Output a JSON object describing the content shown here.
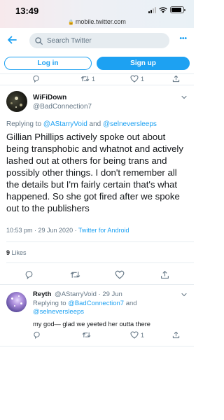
{
  "status_bar": {
    "time": "13:49",
    "url": "mobile.twitter.com"
  },
  "header": {
    "search_placeholder": "Search Twitter"
  },
  "auth": {
    "login_label": "Log in",
    "signup_label": "Sign up"
  },
  "previous_tweet_actions": {
    "retweets": "1",
    "likes": "1"
  },
  "tweet": {
    "display_name": "WiFiDown",
    "handle": "@BadConnection7",
    "replying_prefix": "Replying to ",
    "replying_to_1": "@AStarryVoid",
    "replying_and": " and ",
    "replying_to_2": "@selneversleeps",
    "text": "Gillian Phillips actively spoke out about being transphobic and whatnot and actively lashed out at others for being trans and possibly other things. I don't remember all the details but I'm fairly certain that's what happened. So she got fired after we spoke out to the publishers",
    "time": "10:53 pm",
    "date": "29 Jun 2020",
    "separator": " · ",
    "source": "Twitter for Android",
    "likes_count": "9",
    "likes_label": " Likes"
  },
  "reply": {
    "display_name": "Reyth",
    "handle": "@AStarryVoid",
    "separator": " · ",
    "date": "29 Jun",
    "replying_prefix": "Replying to ",
    "replying_to_1": "@BadConnection7",
    "replying_and": " and",
    "replying_to_2": "@selneversleeps",
    "text": "my god— glad we yeeted her outta there",
    "likes": "1"
  },
  "colors": {
    "accent": "#1da1f2",
    "muted": "#657786",
    "text": "#14171a",
    "divider": "#e6ecf0"
  }
}
